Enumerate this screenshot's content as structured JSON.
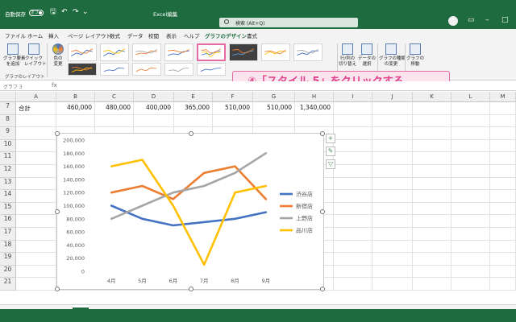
{
  "titlebar": {
    "autosave": "自動保存",
    "autosave_state": "オフ",
    "filename": "Excel編集",
    "search_placeholder": "検索 (Alt+Q)",
    "qa_save": "🖫",
    "qa_undo": "↶",
    "qa_redo": "↷",
    "qa_more": "⌄"
  },
  "tabs": [
    "ファイル",
    "ホーム",
    "挿入",
    "ページ レイアウト",
    "数式",
    "データ",
    "校閲",
    "表示",
    "ヘルプ",
    "グラフのデザイン",
    "書式"
  ],
  "active_tab": 9,
  "ribbon": {
    "add_element": "グラフ要素\nを追加",
    "quick_layout": "クイック\nレイアウト",
    "change_color": "色の\n変更",
    "group_label": "グラフのレイアウト",
    "switch_rowcol": "行/列の\n切り替え",
    "select_data": "データの\n選択",
    "change_type": "グラフの種類\nの変更",
    "move_chart": "グラフの\n移動"
  },
  "callout": "④「スタイル 5」をクリックする",
  "name_box": "グラフ 3",
  "fx": "fx",
  "columns": [
    "A",
    "B",
    "C",
    "D",
    "E",
    "F",
    "G",
    "H",
    "I",
    "J",
    "K",
    "L",
    "M"
  ],
  "rows": [
    "7",
    "8",
    "9",
    "10",
    "11",
    "12",
    "13",
    "14",
    "15",
    "16",
    "17",
    "18",
    "19",
    "20",
    "21"
  ],
  "row7": [
    "合計",
    "460,000",
    "480,000",
    "400,000",
    "365,000",
    "510,000",
    "510,000",
    "1,340,000"
  ],
  "chart_data": {
    "type": "line",
    "categories": [
      "4月",
      "5月",
      "6月",
      "7月",
      "8月",
      "9月"
    ],
    "yticks": [
      "0",
      "20,000",
      "40,000",
      "60,000",
      "80,000",
      "100,000",
      "120,000",
      "140,000",
      "160,000",
      "180,000",
      "200,000"
    ],
    "ylim": [
      0,
      200000
    ],
    "series": [
      {
        "name": "渋谷店",
        "color": "#4472c4",
        "values": [
          100000,
          80000,
          70000,
          75000,
          80000,
          90000
        ]
      },
      {
        "name": "新宿店",
        "color": "#ed7d31",
        "values": [
          120000,
          130000,
          110000,
          150000,
          160000,
          110000
        ]
      },
      {
        "name": "上野店",
        "color": "#a5a5a5",
        "values": [
          80000,
          100000,
          120000,
          130000,
          150000,
          180000
        ]
      },
      {
        "name": "品川店",
        "color": "#ffc000",
        "values": [
          160000,
          170000,
          100000,
          10000,
          120000,
          130000
        ]
      }
    ],
    "legend": "right",
    "grid": false
  }
}
